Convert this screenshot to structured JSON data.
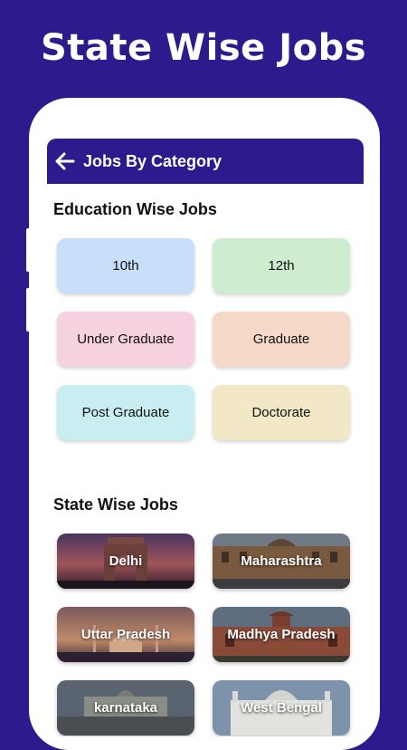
{
  "promo": {
    "title": "State Wise Jobs"
  },
  "appbar": {
    "title": "Jobs By Category",
    "back_icon": "arrow-left-icon"
  },
  "education": {
    "title": "Education Wise Jobs",
    "items": [
      {
        "label": "10th",
        "color": "#c7dff8"
      },
      {
        "label": "12th",
        "color": "#cdecd0"
      },
      {
        "label": "Under Graduate",
        "color": "#f6d2e0"
      },
      {
        "label": "Graduate",
        "color": "#f6d9c9"
      },
      {
        "label": "Post Graduate",
        "color": "#c8eef2"
      },
      {
        "label": "Doctorate",
        "color": "#f3e8c5"
      }
    ]
  },
  "states": {
    "title": "State Wise Jobs",
    "items": [
      {
        "label": "Delhi"
      },
      {
        "label": "Maharashtra"
      },
      {
        "label": "Uttar Pradesh"
      },
      {
        "label": "Madhya Pradesh"
      },
      {
        "label": "karnataka"
      },
      {
        "label": "West Bengal"
      }
    ]
  },
  "colors": {
    "brand": "#2d1a8c",
    "background": "#ffffff"
  }
}
